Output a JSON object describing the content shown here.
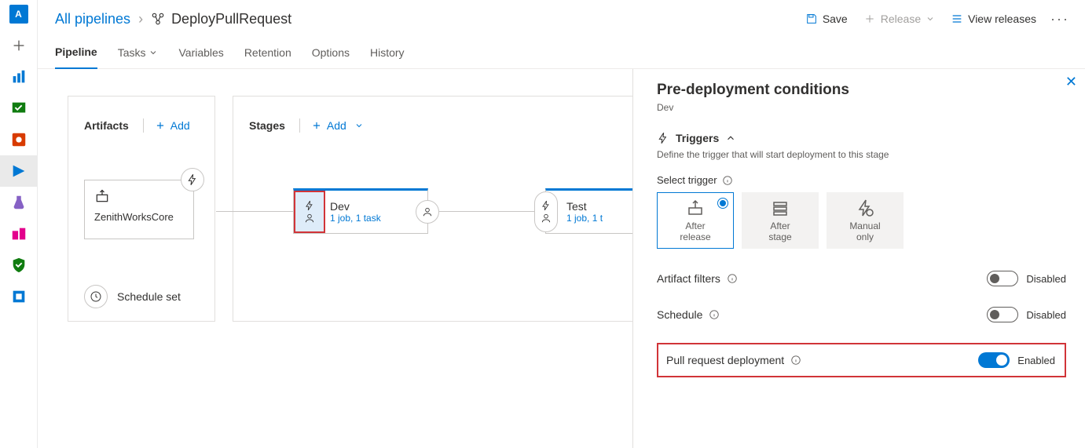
{
  "rail": {
    "avatar": "A"
  },
  "breadcrumb": {
    "root": "All pipelines",
    "current": "DeployPullRequest"
  },
  "header": {
    "save": "Save",
    "release": "Release",
    "view_releases": "View releases"
  },
  "tabs": {
    "pipeline": "Pipeline",
    "tasks": "Tasks",
    "variables": "Variables",
    "retention": "Retention",
    "options": "Options",
    "history": "History"
  },
  "artifacts": {
    "title": "Artifacts",
    "add": "Add",
    "card_name": "ZenithWorksCore",
    "schedule_set": "Schedule set"
  },
  "stages": {
    "title": "Stages",
    "add": "Add",
    "items": [
      {
        "name": "Dev",
        "sub": "1 job, 1 task"
      },
      {
        "name": "Test",
        "sub": "1 job, 1 t"
      }
    ]
  },
  "panel": {
    "title": "Pre-deployment conditions",
    "stage": "Dev",
    "triggers_title": "Triggers",
    "triggers_desc": "Define the trigger that will start deployment to this stage",
    "select_trigger": "Select trigger",
    "opts": {
      "after_release": "After\nrelease",
      "after_stage": "After\nstage",
      "manual_only": "Manual\nonly"
    },
    "artifact_filters": "Artifact filters",
    "schedule": "Schedule",
    "pull_request": "Pull request deployment",
    "disabled": "Disabled",
    "enabled": "Enabled"
  }
}
